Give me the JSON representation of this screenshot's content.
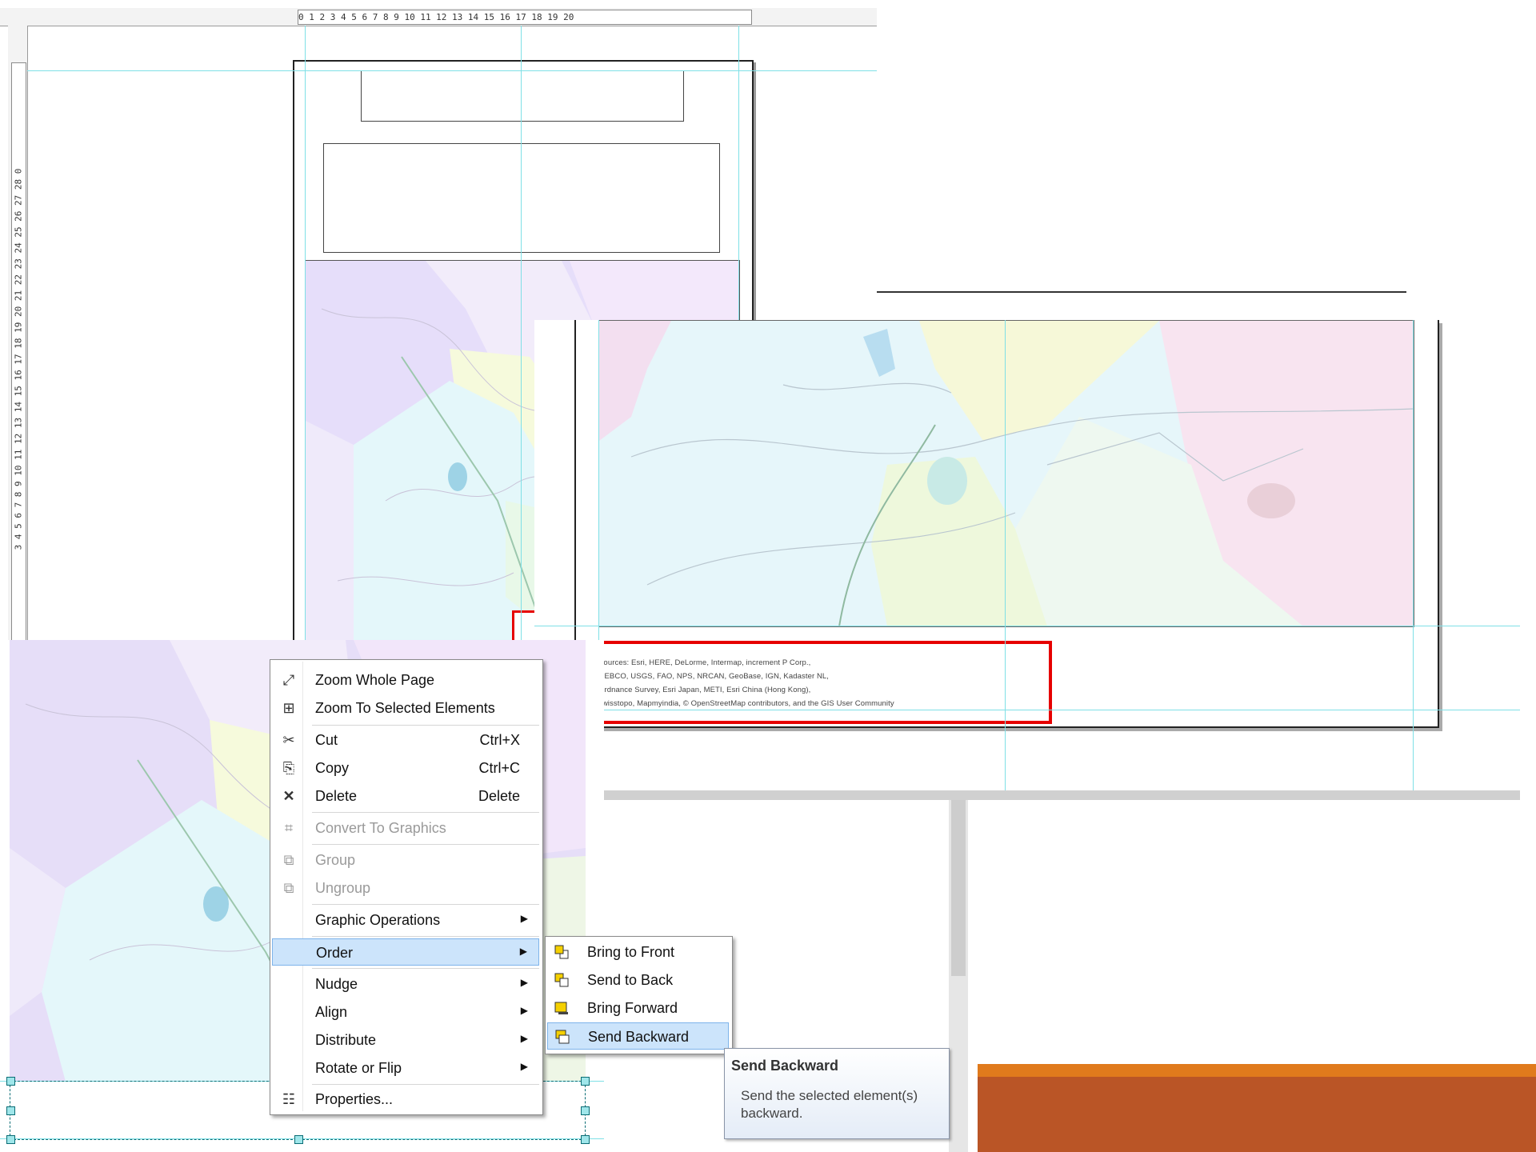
{
  "rulers": {
    "horizontal_label": "0 1 2 3 4 5 6 7 8 9 10 11 12 13 14 15 16 17 18 19 20",
    "vertical_label": "3 4 5 6 7 8 9 10 11 12 13 14 15 16 17 18 19 20 21 22 23 24 25 26 27 28 0"
  },
  "credits": {
    "lines": [
      "Sources: Esri, HERE, DeLorme, Intermap, increment P Corp.,",
      "GEBCO, USGS, FAO, NPS, NRCAN, GeoBase, IGN, Kadaster NL,",
      "Ordnance Survey, Esri Japan, METI, Esri China (Hong Kong),",
      "swisstopo, Mapmyindia, © OpenStreetMap contributors, and the GIS User Community"
    ]
  },
  "context_menu": {
    "items": [
      {
        "label": "Zoom Whole Page",
        "icon": "zoom-whole-page-icon",
        "glyph": "⤢"
      },
      {
        "label": "Zoom To Selected Elements",
        "icon": "zoom-selected-icon",
        "glyph": "⊞"
      },
      {
        "label": "Cut",
        "shortcut": "Ctrl+X",
        "icon": "scissors-icon",
        "glyph": "✂"
      },
      {
        "label": "Copy",
        "shortcut": "Ctrl+C",
        "icon": "copy-icon",
        "glyph": "⎘"
      },
      {
        "label": "Delete",
        "shortcut": "Delete",
        "icon": "delete-x-icon",
        "glyph": "✕"
      },
      {
        "label": "Convert To Graphics",
        "disabled": true,
        "icon": "convert-graphics-icon",
        "glyph": "⌗"
      },
      {
        "label": "Group",
        "disabled": true,
        "icon": "group-icon",
        "glyph": "⧉"
      },
      {
        "label": "Ungroup",
        "disabled": true,
        "icon": "ungroup-icon",
        "glyph": "⧉"
      },
      {
        "label": "Graphic Operations",
        "submenu": true
      },
      {
        "label": "Order",
        "submenu": true,
        "highlighted": true
      },
      {
        "label": "Nudge",
        "submenu": true
      },
      {
        "label": "Align",
        "submenu": true
      },
      {
        "label": "Distribute",
        "submenu": true
      },
      {
        "label": "Rotate or Flip",
        "submenu": true
      },
      {
        "label": "Properties...",
        "icon": "properties-icon",
        "glyph": "☷"
      }
    ],
    "submenu_arrow": "▶"
  },
  "order_submenu": {
    "items": [
      {
        "label": "Bring to Front",
        "icon": "bring-to-front-icon"
      },
      {
        "label": "Send to Back",
        "icon": "send-to-back-icon"
      },
      {
        "label": "Bring Forward",
        "icon": "bring-forward-icon"
      },
      {
        "label": "Send Backward",
        "icon": "send-backward-icon",
        "highlighted": true
      }
    ]
  },
  "tooltip": {
    "title": "Send Backward",
    "body": "Send the selected element(s) backward."
  },
  "colors": {
    "highlight_red": "#e60000",
    "guide_cyan": "#7fe0e6",
    "menu_highlight": "#cce4fb",
    "band_orange": "#e07a1c",
    "band_brown": "#ba5526"
  }
}
